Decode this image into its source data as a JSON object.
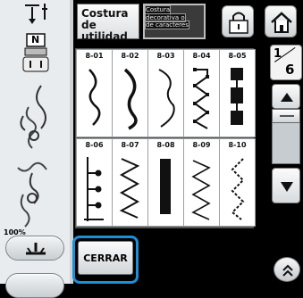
{
  "header": {
    "tab_utility": "Costura de utilidad",
    "tab_decorative_lines": [
      "Costura",
      "decorativa o",
      "de caracteres"
    ]
  },
  "presser_foot_letter": "N",
  "zoom_label": "100%",
  "patterns": [
    {
      "code": "8-01",
      "icon": "zigzag-wave-stitch-icon"
    },
    {
      "code": "8-02",
      "icon": "bold-wave-stitch-icon"
    },
    {
      "code": "8-03",
      "icon": "serpentine-stitch-icon"
    },
    {
      "code": "8-04",
      "icon": "square-zigzag-stitch-icon"
    },
    {
      "code": "8-05",
      "icon": "block-satin-stitch-icon"
    },
    {
      "code": "8-06",
      "icon": "dotted-branch-stitch-icon"
    },
    {
      "code": "8-07",
      "icon": "zigzag-stitch-icon"
    },
    {
      "code": "8-08",
      "icon": "satin-bar-stitch-icon"
    },
    {
      "code": "8-09",
      "icon": "narrow-zigzag-stitch-icon"
    },
    {
      "code": "8-10",
      "icon": "dotted-zigzag-stitch-icon"
    }
  ],
  "page": {
    "current": "1",
    "total": "6"
  },
  "close_label": "CERRAR",
  "colors": {
    "focus": "#1c8fd6",
    "panel": "#e9ecef",
    "background": "#000000"
  }
}
